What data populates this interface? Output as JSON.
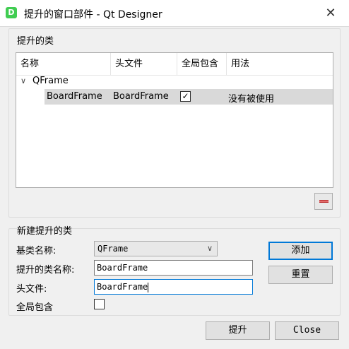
{
  "window": {
    "icon_letter": "D",
    "title": "提升的窗口部件 - Qt Designer",
    "close_glyph": "✕"
  },
  "promoted": {
    "group_title": "提升的类",
    "columns": [
      "名称",
      "头文件",
      "全局包含",
      "用法"
    ],
    "parent": "QFrame",
    "row": {
      "name": "BoardFrame",
      "header": "BoardFrame",
      "global_include": true,
      "usage": "没有被使用"
    },
    "check_glyph": "✓"
  },
  "new_promoted": {
    "group_title": "新建提升的类",
    "base_class_label": "基类名称:",
    "base_class_value": "QFrame",
    "class_name_label": "提升的类名称:",
    "class_name_value": "BoardFrame",
    "header_label": "头文件:",
    "header_value": "BoardFrame",
    "global_include_label": "全局包含",
    "global_include_checked": false,
    "add_label": "添加",
    "reset_label": "重置"
  },
  "footer": {
    "promote_label": "提升",
    "close_label": "Close"
  }
}
